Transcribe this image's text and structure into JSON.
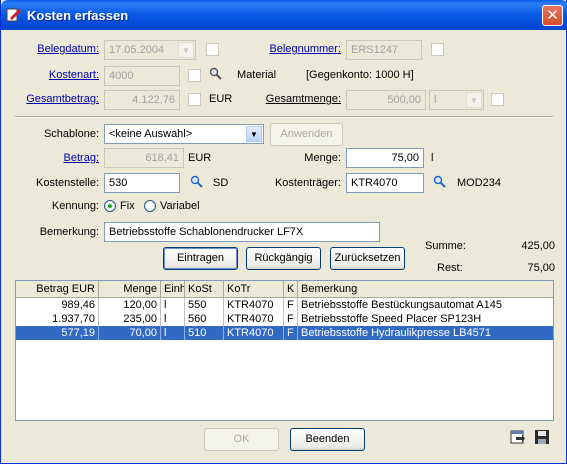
{
  "window": {
    "title": "Kosten erfassen",
    "close_glyph": "✕"
  },
  "form": {
    "belegdatum": {
      "label": "Belegdatum:",
      "value": "17.05.2004"
    },
    "belegnummer": {
      "label": "Belegnummer:",
      "value": "ERS1247"
    },
    "kostenart": {
      "label": "Kostenart:",
      "value": "4000",
      "hint": "Material",
      "gegenkonto": "[Gegenkonto: 1000 H]"
    },
    "gesamtbetrag": {
      "label": "Gesamtbetrag:",
      "value": "4.122,76",
      "unit": "EUR"
    },
    "gesamtmenge": {
      "label": "Gesamtmenge:",
      "value": "500,00",
      "unit_value": "l"
    },
    "schablone": {
      "label": "Schablone:",
      "value": "<keine Auswahl>",
      "apply_label": "Anwenden"
    },
    "betrag": {
      "label": "Betrag:",
      "value": "618,41",
      "unit": "EUR"
    },
    "menge": {
      "label": "Menge:",
      "value": "75,00",
      "unit": "l"
    },
    "kostenstelle": {
      "label": "Kostenstelle:",
      "value": "530",
      "hint": "SD"
    },
    "kostentraeger": {
      "label": "Kostenträger:",
      "value": "KTR4070",
      "hint": "MOD234"
    },
    "kennung": {
      "label": "Kennung:",
      "opt_fix": "Fix",
      "opt_variabel": "Variabel",
      "selected": "Fix"
    },
    "bemerkung": {
      "label": "Bemerkung:",
      "value": "Betriebsstoffe Schablonendrucker LF7X"
    }
  },
  "summary": {
    "summe_label": "Summe:",
    "summe_value": "425,00",
    "rest_label": "Rest:",
    "rest_value": "75,00"
  },
  "actions": {
    "eintragen": "Eintragen",
    "rueckgaengig": "Rückgängig",
    "zuruecksetzen": "Zurücksetzen"
  },
  "table": {
    "columns": [
      "Betrag EUR",
      "Menge",
      "Einh",
      "KoSt",
      "KoTr",
      "K",
      "Bemerkung"
    ],
    "rows": [
      [
        "989,46",
        "120,00",
        "l",
        "550",
        "KTR4070",
        "F",
        "Betriebsstoffe Bestückungsautomat A145"
      ],
      [
        "1.937,70",
        "235,00",
        "l",
        "560",
        "KTR4070",
        "F",
        "Betriebsstoffe Speed Placer SP123H"
      ],
      [
        "577,19",
        "70,00",
        "l",
        "510",
        "KTR4070",
        "F",
        "Betriebsstoffe Hydraulikpresse LB4571"
      ]
    ],
    "selected_row": 2
  },
  "footer": {
    "ok_label": "OK",
    "beenden_label": "Beenden"
  },
  "colors": {
    "title_bar": "#0a5ce8",
    "selection": "#316ac5",
    "window_bg": "#ece9d8",
    "link": "#0000b0"
  },
  "icons": [
    "app-icon",
    "close-icon",
    "magnifier-icon",
    "export-icon",
    "save-icon"
  ]
}
